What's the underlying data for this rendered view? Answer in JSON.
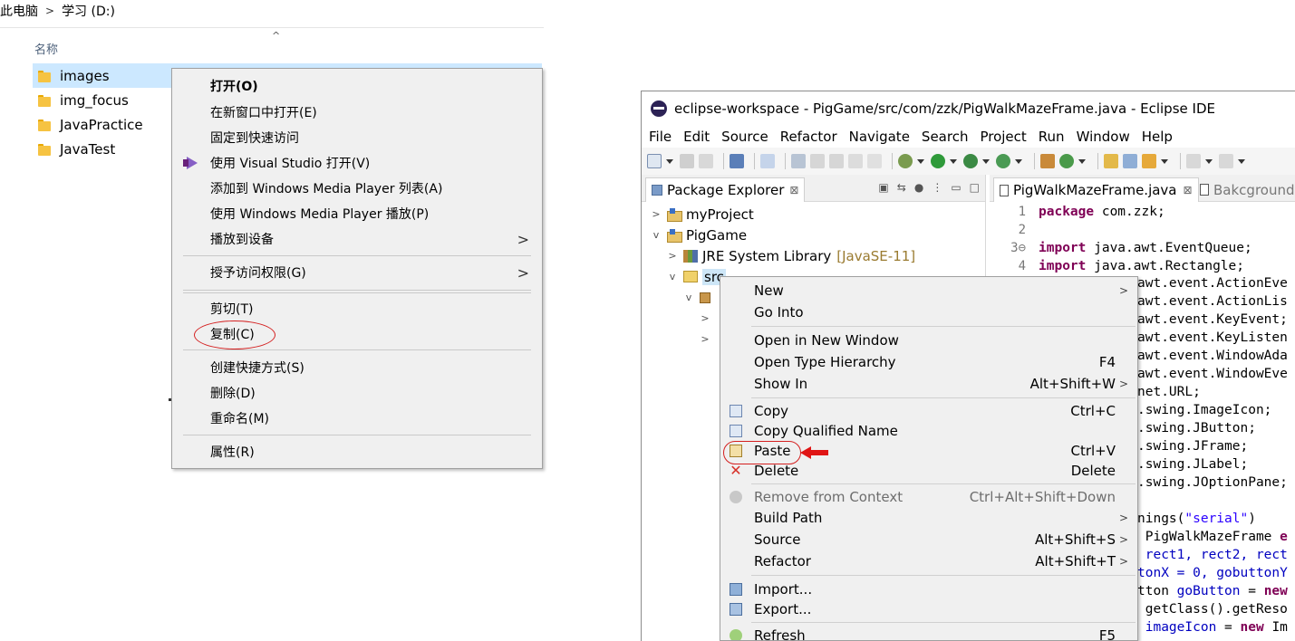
{
  "explorer": {
    "breadcrumb": [
      "此电脑",
      "学习 (D:)"
    ],
    "breadcrumb_separator": ">",
    "column_name": "名称",
    "files": [
      "images",
      "img_focus",
      "JavaPractice",
      "JavaTest"
    ],
    "context_menu": {
      "open": "打开(O)",
      "open_new_window": "在新窗口中打开(E)",
      "pin_quick_access": "固定到快速访问",
      "open_visual_studio": "使用 Visual Studio 打开(V)",
      "add_wmp_list": "添加到 Windows Media Player 列表(A)",
      "play_wmp": "使用 Windows Media Player 播放(P)",
      "cast_to_device": "播放到设备",
      "grant_access": "授予访问权限(G)",
      "cut": "剪切(T)",
      "copy": "复制(C)",
      "create_shortcut": "创建快捷方式(S)",
      "delete": "删除(D)",
      "rename": "重命名(M)",
      "properties": "属性(R)"
    }
  },
  "eclipse": {
    "title": "eclipse-workspace - PigGame/src/com/zzk/PigWalkMazeFrame.java - Eclipse IDE",
    "menu": [
      "File",
      "Edit",
      "Source",
      "Refactor",
      "Navigate",
      "Search",
      "Project",
      "Run",
      "Window",
      "Help"
    ],
    "package_explorer": {
      "tab_label": "Package Explorer",
      "close_glyph": "⊠",
      "tree": {
        "project1": "myProject",
        "project2": "PigGame",
        "jre": "JRE System Library",
        "jre_version": "[JavaSE-11]",
        "src": "src"
      }
    },
    "editor": {
      "active_tab": "PigWalkMazeFrame.java",
      "close_glyph": "⊠",
      "inactive_tab": "Bakcground",
      "line_numbers": [
        "1",
        "2",
        "3⊖",
        "4"
      ],
      "lines": [
        {
          "kw": "package",
          "rest": " com.zzk;"
        },
        {
          "kw": "",
          "rest": ""
        },
        {
          "kw": "import",
          "rest": " java.awt.EventQueue;"
        },
        {
          "kw": "import",
          "rest": " java.awt.Rectangle;"
        }
      ],
      "right_fragments": [
        "awt.event.ActionEve",
        "awt.event.ActionLis",
        "awt.event.KeyEvent;",
        "awt.event.KeyListen",
        "awt.event.WindowAda",
        "awt.event.WindowEve",
        "net.URL;",
        ".swing.ImageIcon;",
        ".swing.JButton;",
        ".swing.JFrame;",
        ".swing.JLabel;",
        ".swing.JOptionPane;"
      ],
      "lower_fragments": {
        "warnings_pre": "nings(",
        "warnings_str": "\"serial\"",
        "warnings_post": ")",
        "class_line": " PigWalkMazeFrame ",
        "class_kw": "e",
        "rect_line": " rect1, rect2, rect",
        "gobutton_line": "tonX = 0, gobuttonY",
        "button_pre": "tton ",
        "button_field": "goButton",
        "button_mid": " = ",
        "button_kw": "new",
        "getclass_line": " getClass().getReso",
        "imageicon_field": " imageIcon",
        "imageicon_mid": " = ",
        "imageicon_kw": "new",
        "imageicon_post": " Im"
      }
    },
    "context_menu": {
      "new": "New",
      "go_into": "Go Into",
      "open_new_window": "Open in New Window",
      "open_type_hierarchy": "Open Type Hierarchy",
      "open_type_hierarchy_sc": "F4",
      "show_in": "Show In",
      "show_in_sc": "Alt+Shift+W",
      "copy": "Copy",
      "copy_sc": "Ctrl+C",
      "copy_qualified": "Copy Qualified Name",
      "paste": "Paste",
      "paste_sc": "Ctrl+V",
      "delete": "Delete",
      "delete_sc": "Delete",
      "remove_context": "Remove from Context",
      "remove_context_sc": "Ctrl+Alt+Shift+Down",
      "build_path": "Build Path",
      "source": "Source",
      "source_sc": "Alt+Shift+S",
      "refactor": "Refactor",
      "refactor_sc": "Alt+Shift+T",
      "import": "Import...",
      "export": "Export...",
      "refresh": "Refresh",
      "refresh_sc": "F5"
    }
  }
}
